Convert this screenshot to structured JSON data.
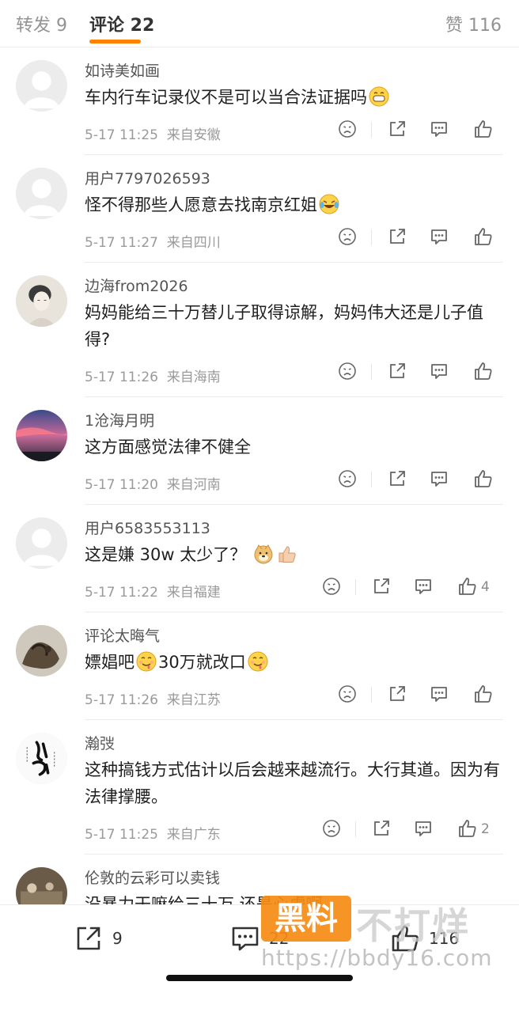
{
  "tabs": {
    "repost": "转发 9",
    "comments": "评论 22",
    "likes": "赞 116"
  },
  "comments": [
    {
      "user": "如诗美如画",
      "text": "车内行车记录仪不是可以当合法证据吗",
      "emojis": [
        "grin"
      ],
      "time": "5-17 11:25",
      "location": "来自安徽",
      "likes": "",
      "avatar": "default"
    },
    {
      "user": "用户7797026593",
      "text": "怪不得那些人愿意去找南京红姐",
      "emojis": [
        "laugh-cry"
      ],
      "time": "5-17 11:27",
      "location": "来自四川",
      "likes": "",
      "avatar": "default"
    },
    {
      "user": "边海from2026",
      "text": "妈妈能给三十万替儿子取得谅解，妈妈伟大还是儿子值得?",
      "emojis": [],
      "time": "5-17 11:26",
      "location": "来自海南",
      "likes": "",
      "avatar": "portrait"
    },
    {
      "user": "1沧海月明",
      "text": "这方面感觉法律不健全",
      "emojis": [],
      "time": "5-17 11:20",
      "location": "来自河南",
      "likes": "",
      "avatar": "sky"
    },
    {
      "user": "用户6583553113",
      "text": "这是嫌 30w 太少了？",
      "emojis": [
        "doge",
        "thumbs-up"
      ],
      "time": "5-17 11:22",
      "location": "来自福建",
      "likes": "4",
      "avatar": "default"
    },
    {
      "user": "评论太晦气",
      "text_parts": [
        "嫖娼吧",
        "30万就改口",
        ""
      ],
      "emojis": [
        "drool",
        "drool"
      ],
      "time": "5-17 11:26",
      "location": "来自江苏",
      "likes": "",
      "avatar": "dragon"
    },
    {
      "user": "瀚弢",
      "text": "这种搞钱方式估计以后会越来越流行。大行其道。因为有法律撑腰。",
      "emojis": [],
      "time": "5-17 11:25",
      "location": "来自广东",
      "likes": "2",
      "avatar": "calligraphy"
    },
    {
      "user": "伦敦的云彩可以卖钱",
      "text": "没暴力干嘛给三十万 还是心虚啊",
      "emojis": [],
      "time": "",
      "location": "",
      "likes": "",
      "avatar": "room"
    }
  ],
  "bottom_bar": {
    "repost_count": "9",
    "comment_count": "22",
    "like_count": "116"
  },
  "watermark": {
    "box_text": "黑料",
    "text": "不打烊",
    "url": "https://bbdy16.com"
  },
  "colors": {
    "accent": "#ff8200",
    "text_primary": "#1f1f1f",
    "text_secondary": "#9a9a9a"
  }
}
